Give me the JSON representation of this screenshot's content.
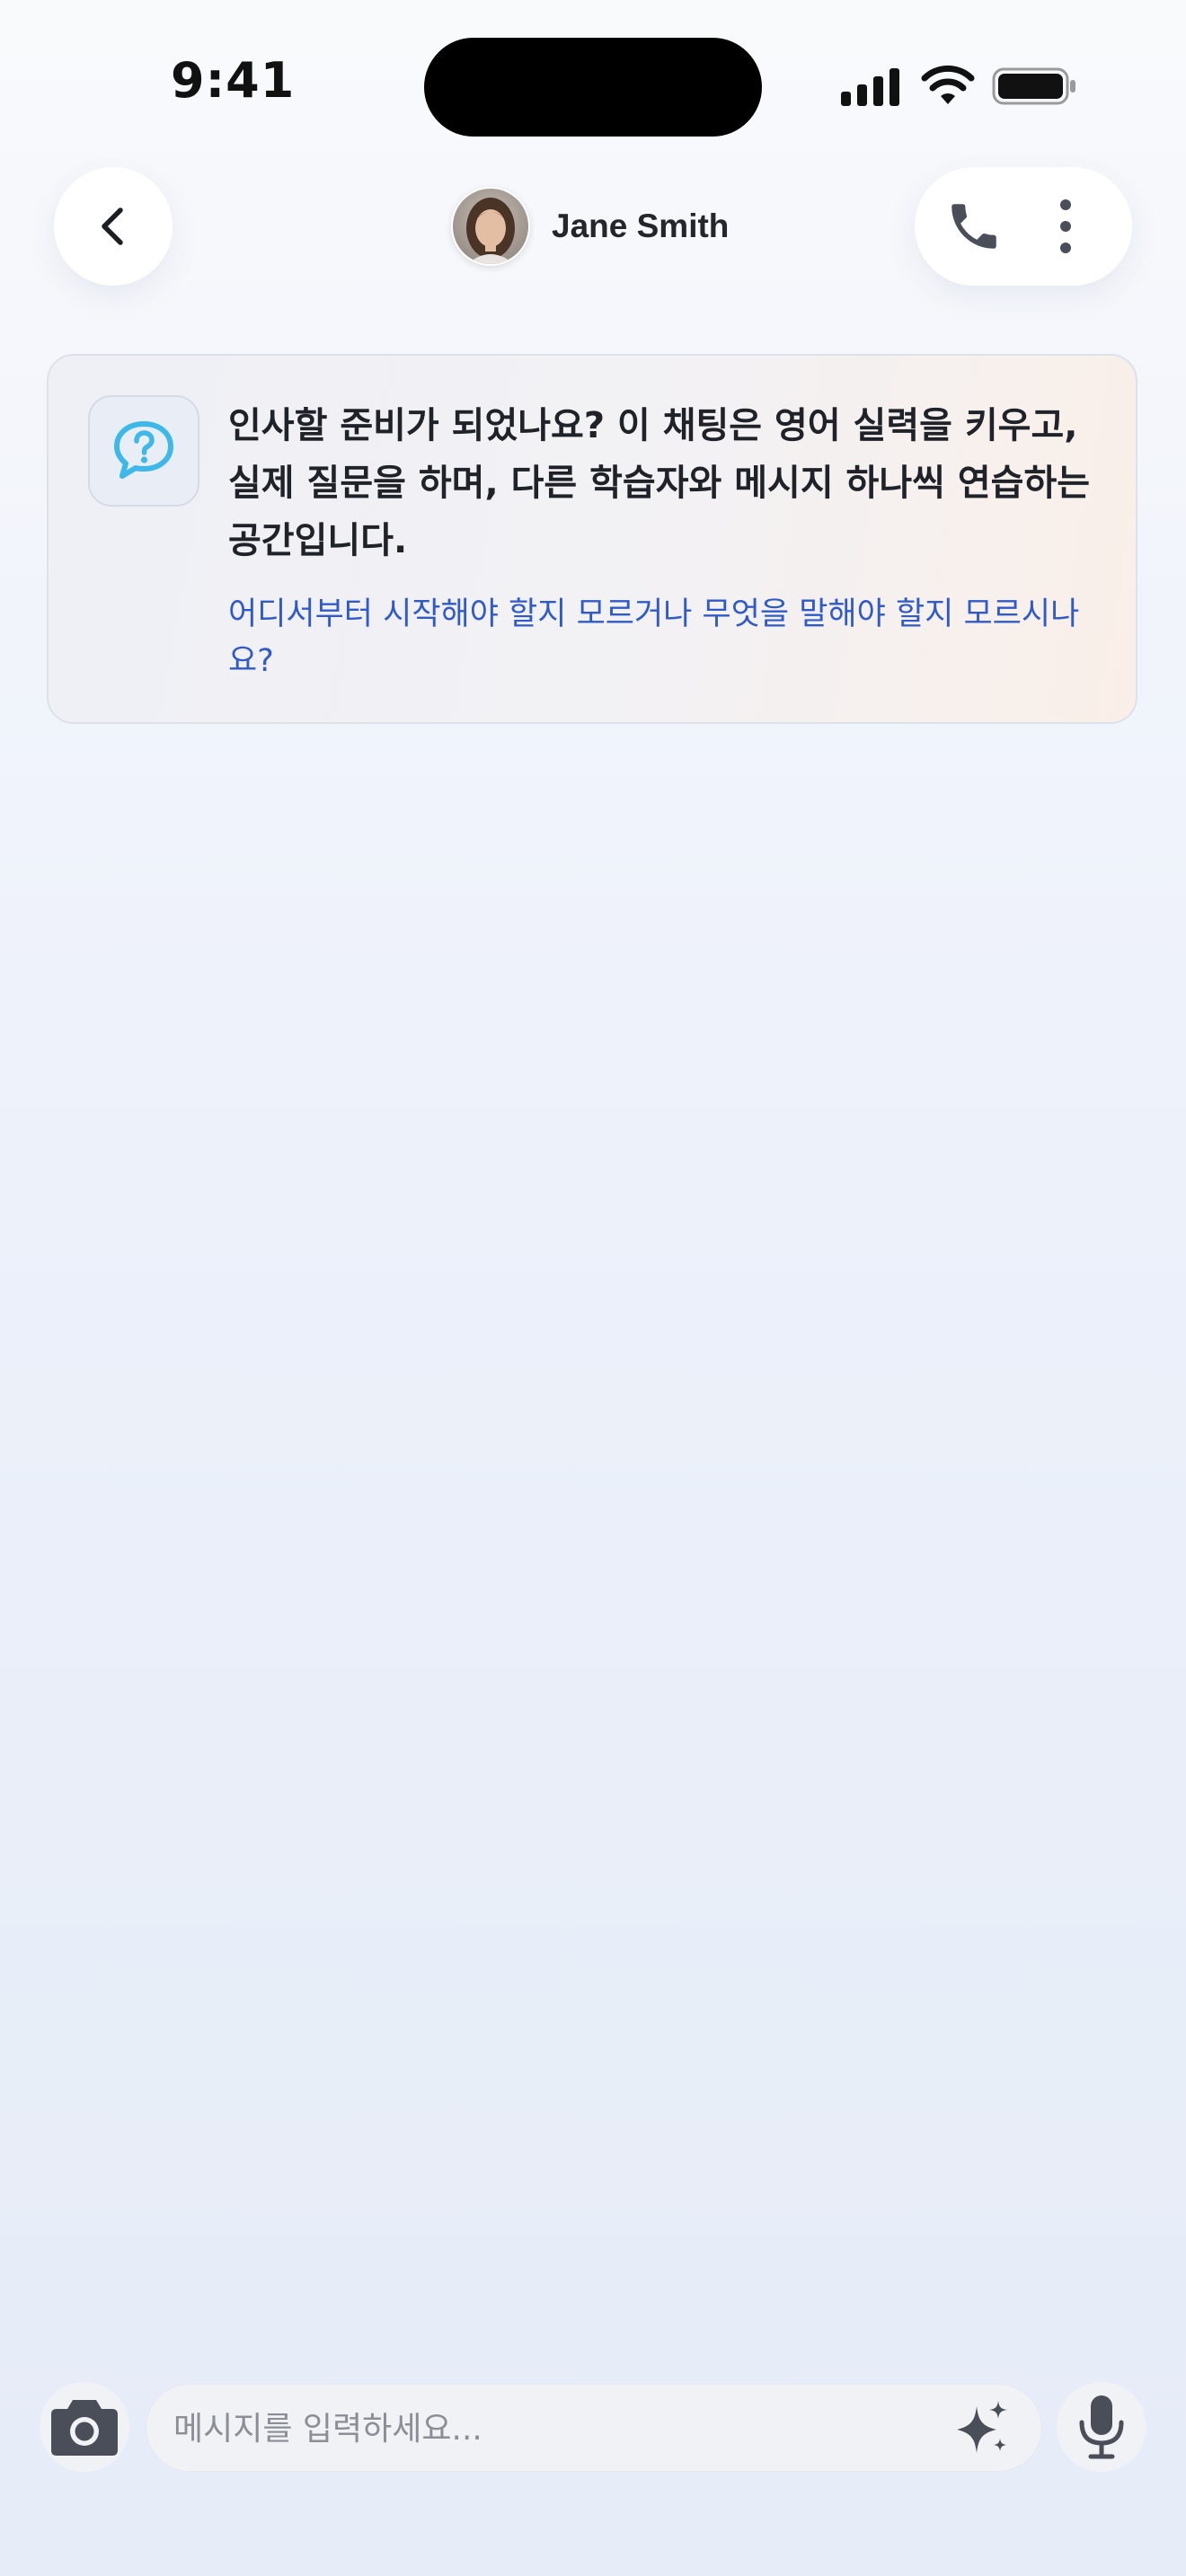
{
  "status_bar": {
    "time": "9:41"
  },
  "header": {
    "contact_name": "Jane Smith",
    "icons": {
      "back": "chevron-left-icon",
      "phone": "phone-icon",
      "more": "more-vertical-icon"
    }
  },
  "intro_card": {
    "icon": "question-bubble-icon",
    "message": "인사할 준비가 되었나요? 이 채팅은 영어 실력을 키우고, 실제 질문을 하며, 다른 학습자와 메시지 하나씩 연습하는 공간입니다.",
    "help_link": "어디서부터 시작해야 할지 모르거나 무엇을 말해야 할지 모르시나요?"
  },
  "composer": {
    "placeholder": "메시지를 입력하세요...",
    "icons": {
      "camera": "camera-icon",
      "sparkle": "sparkle-icon",
      "mic": "microphone-icon"
    }
  },
  "colors": {
    "link": "#2f5ac8",
    "help_icon": "#3db8e8",
    "icon_dark": "#4a4e58"
  }
}
